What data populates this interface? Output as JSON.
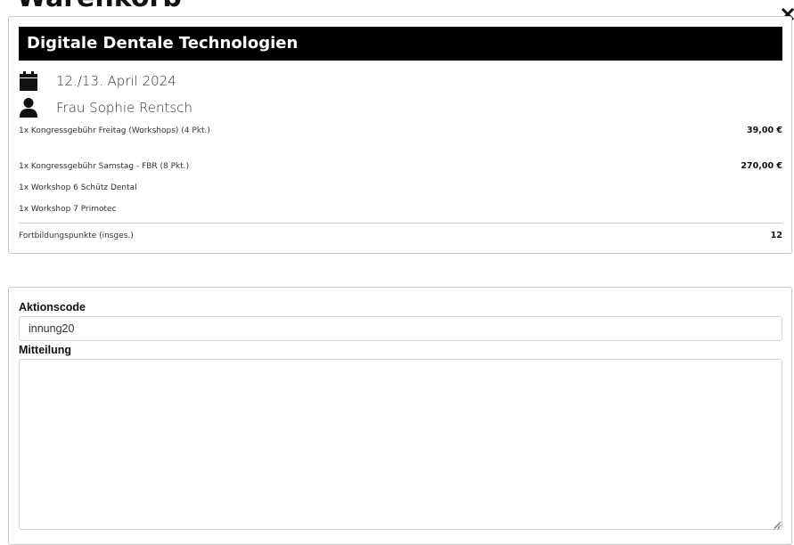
{
  "page": {
    "title": "Warenkorb",
    "close_icon": "close-icon"
  },
  "cart": {
    "event_title": "Digitale Dentale Technologien",
    "date_icon": "calendar-icon",
    "date": "12./13. April 2024",
    "person_icon": "user-icon",
    "person": "Frau Sophie Rentsch",
    "items": [
      {
        "description": "1x Kongressgebühr Freitag (Workshops) (4 Pkt.)",
        "price": "39,00 €"
      },
      {
        "description": "1x Kongressgebühr Samstag - FBR (8 Pkt.)",
        "price": "270,00 €"
      },
      {
        "description": "1x Workshop 6 Schütz Dental",
        "price": ""
      },
      {
        "description": "1x Workshop 7 Primotec",
        "price": ""
      }
    ],
    "points_label": "Fortbildungspunkte (insges.)",
    "points_total": "12"
  },
  "form": {
    "promo_label": "Aktionscode",
    "promo_value": "innung20",
    "message_label": "Mitteilung",
    "message_value": ""
  },
  "colors": {
    "header_bg": "#000000",
    "header_text": "#ffffff",
    "border": "#c8c8c8"
  }
}
